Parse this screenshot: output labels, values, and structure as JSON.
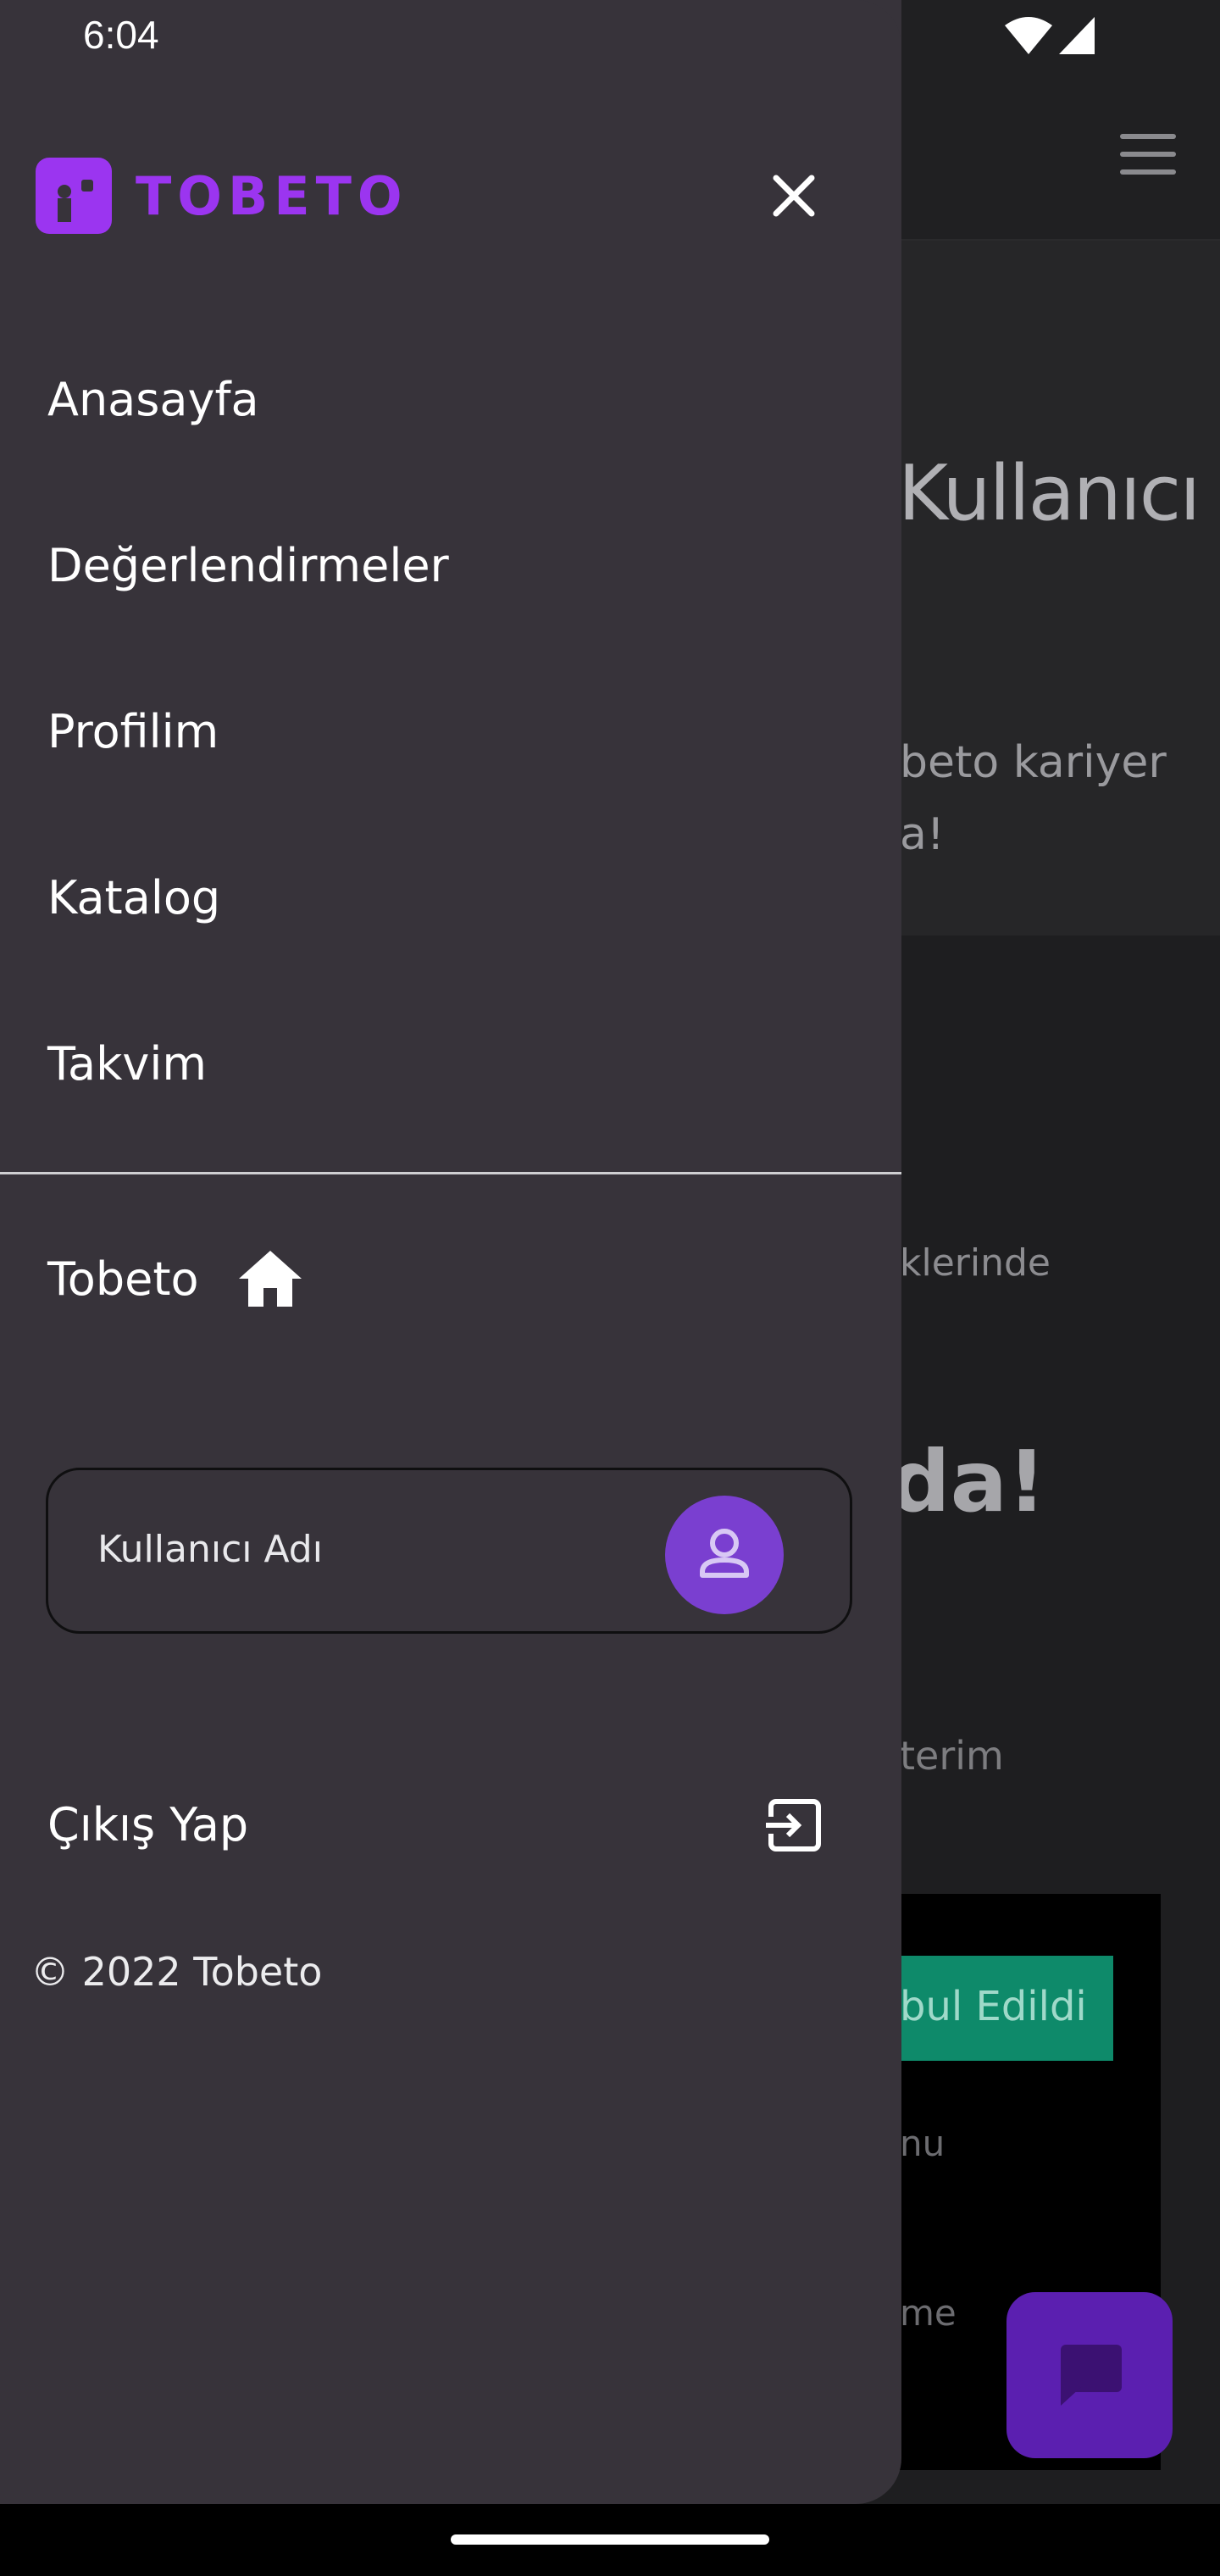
{
  "status_bar": {
    "time": "6:04"
  },
  "background_page": {
    "title_fragment": "Kullanıcı",
    "subtitle_line1": "beto kariyer",
    "subtitle_line2": "a!",
    "text_fragment": "klerinde",
    "big_text": "da!",
    "section_fragment": "terim",
    "badge_text": "bul Edildi",
    "card_text1": "nu",
    "card_text2": "me"
  },
  "drawer": {
    "logo_text": "TOBETO",
    "menu": [
      {
        "label": "Anasayfa"
      },
      {
        "label": "Değerlendirmeler"
      },
      {
        "label": "Profilim"
      },
      {
        "label": "Katalog"
      },
      {
        "label": "Takvim"
      }
    ],
    "home_link": "Tobeto",
    "user_name": "Kullanıcı Adı",
    "logout_label": "Çıkış Yap",
    "copyright": "© 2022 Tobeto"
  },
  "colors": {
    "brand_purple": "#9b35f0",
    "drawer_bg": "#37333a",
    "avatar_bg": "#7a3fd0",
    "badge_green": "#0e8a6a"
  },
  "icons": [
    "wifi-icon",
    "signal-icon",
    "close-icon",
    "home-icon",
    "user-icon",
    "logout-icon",
    "menu-icon",
    "chat-icon"
  ]
}
